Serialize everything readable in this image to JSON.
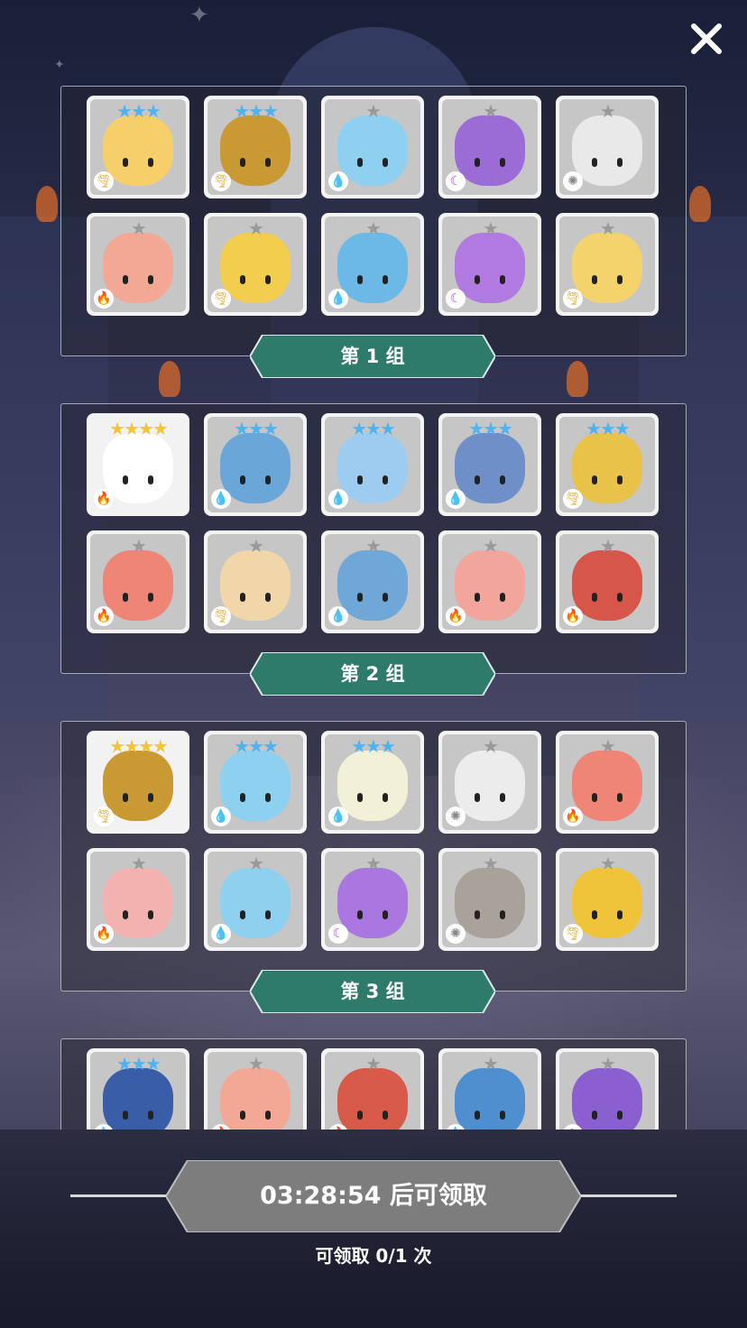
{
  "close_label": "✕",
  "groups": [
    {
      "label": "第 1 组",
      "heroes": [
        {
          "stars": "★★★",
          "star_color": "#4fb3f0",
          "element": "wind",
          "element_glyph": "🌪",
          "element_color": "#e8a21a",
          "color": "#f6cf6a",
          "gold": false
        },
        {
          "stars": "★★★",
          "star_color": "#4fb3f0",
          "element": "wind",
          "element_glyph": "🌪",
          "element_color": "#e8a21a",
          "color": "#c99a33",
          "gold": false
        },
        {
          "stars": "★",
          "star_color": "#9a9a9a",
          "element": "water",
          "element_glyph": "💧",
          "element_color": "#3a8fe0",
          "color": "#8fcfef",
          "gold": false
        },
        {
          "stars": "★",
          "star_color": "#9a9a9a",
          "element": "dark",
          "element_glyph": "☾",
          "element_color": "#b14ad8",
          "color": "#9b6bd6",
          "gold": false
        },
        {
          "stars": "★",
          "star_color": "#9a9a9a",
          "element": "light",
          "element_glyph": "✺",
          "element_color": "#888888",
          "color": "#e9e9e9",
          "gold": false
        },
        {
          "stars": "★",
          "star_color": "#9a9a9a",
          "element": "fire",
          "element_glyph": "🔥",
          "element_color": "#e25a2a",
          "color": "#f3a895",
          "gold": false
        },
        {
          "stars": "★",
          "star_color": "#9a9a9a",
          "element": "wind",
          "element_glyph": "🌪",
          "element_color": "#e8a21a",
          "color": "#f3cd4e",
          "gold": false
        },
        {
          "stars": "★",
          "star_color": "#9a9a9a",
          "element": "water",
          "element_glyph": "💧",
          "element_color": "#3a8fe0",
          "color": "#6cb9e8",
          "gold": false
        },
        {
          "stars": "★",
          "star_color": "#9a9a9a",
          "element": "dark",
          "element_glyph": "☾",
          "element_color": "#b14ad8",
          "color": "#b07ae0",
          "gold": false
        },
        {
          "stars": "★",
          "star_color": "#9a9a9a",
          "element": "wind",
          "element_glyph": "🌪",
          "element_color": "#e8a21a",
          "color": "#f5d36c",
          "gold": false
        }
      ]
    },
    {
      "label": "第 2 组",
      "heroes": [
        {
          "stars": "★★★★",
          "star_color": "#f2c53a",
          "element": "fire",
          "element_glyph": "🔥",
          "element_color": "#e25a2a",
          "color": "#ffffff",
          "gold": true
        },
        {
          "stars": "★★★",
          "star_color": "#4fb3f0",
          "element": "water",
          "element_glyph": "💧",
          "element_color": "#3a8fe0",
          "color": "#6aa7d8",
          "gold": false
        },
        {
          "stars": "★★★",
          "star_color": "#4fb3f0",
          "element": "water",
          "element_glyph": "💧",
          "element_color": "#3a8fe0",
          "color": "#9ecbf0",
          "gold": false
        },
        {
          "stars": "★★★",
          "star_color": "#4fb3f0",
          "element": "water",
          "element_glyph": "💧",
          "element_color": "#3a8fe0",
          "color": "#6f8fc8",
          "gold": false
        },
        {
          "stars": "★★★",
          "star_color": "#4fb3f0",
          "element": "wind",
          "element_glyph": "🌪",
          "element_color": "#e8a21a",
          "color": "#e9c24a",
          "gold": false
        },
        {
          "stars": "★",
          "star_color": "#9a9a9a",
          "element": "fire",
          "element_glyph": "🔥",
          "element_color": "#e25a2a",
          "color": "#ef8577",
          "gold": false
        },
        {
          "stars": "★",
          "star_color": "#9a9a9a",
          "element": "wind",
          "element_glyph": "🌪",
          "element_color": "#e8a21a",
          "color": "#f0d6a8",
          "gold": false
        },
        {
          "stars": "★",
          "star_color": "#9a9a9a",
          "element": "water",
          "element_glyph": "💧",
          "element_color": "#3a8fe0",
          "color": "#6fa8d8",
          "gold": false
        },
        {
          "stars": "★",
          "star_color": "#9a9a9a",
          "element": "fire",
          "element_glyph": "🔥",
          "element_color": "#e25a2a",
          "color": "#f2a59a",
          "gold": false
        },
        {
          "stars": "★",
          "star_color": "#9a9a9a",
          "element": "fire",
          "element_glyph": "🔥",
          "element_color": "#e25a2a",
          "color": "#d7564a",
          "gold": false
        }
      ]
    },
    {
      "label": "第 3 组",
      "heroes": [
        {
          "stars": "★★★★",
          "star_color": "#f2c53a",
          "element": "wind",
          "element_glyph": "🌪",
          "element_color": "#e8a21a",
          "color": "#c99a33",
          "gold": true
        },
        {
          "stars": "★★★",
          "star_color": "#4fb3f0",
          "element": "water",
          "element_glyph": "💧",
          "element_color": "#3a8fe0",
          "color": "#8ed0ef",
          "gold": false
        },
        {
          "stars": "★★★",
          "star_color": "#4fb3f0",
          "element": "water",
          "element_glyph": "💧",
          "element_color": "#3a8fe0",
          "color": "#f3f0d8",
          "gold": false
        },
        {
          "stars": "★",
          "star_color": "#9a9a9a",
          "element": "light",
          "element_glyph": "✺",
          "element_color": "#888888",
          "color": "#ececec",
          "gold": false
        },
        {
          "stars": "★",
          "star_color": "#9a9a9a",
          "element": "fire",
          "element_glyph": "🔥",
          "element_color": "#e25a2a",
          "color": "#ef8577",
          "gold": false
        },
        {
          "stars": "★",
          "star_color": "#9a9a9a",
          "element": "fire",
          "element_glyph": "🔥",
          "element_color": "#e25a2a",
          "color": "#f2b3b0",
          "gold": false
        },
        {
          "stars": "★",
          "star_color": "#9a9a9a",
          "element": "water",
          "element_glyph": "💧",
          "element_color": "#3a8fe0",
          "color": "#8fd0ef",
          "gold": false
        },
        {
          "stars": "★",
          "star_color": "#9a9a9a",
          "element": "dark",
          "element_glyph": "☾",
          "element_color": "#b14ad8",
          "color": "#a977df",
          "gold": false
        },
        {
          "stars": "★",
          "star_color": "#9a9a9a",
          "element": "light",
          "element_glyph": "✺",
          "element_color": "#888888",
          "color": "#a8a29a",
          "gold": false
        },
        {
          "stars": "★",
          "star_color": "#9a9a9a",
          "element": "wind",
          "element_glyph": "🌪",
          "element_color": "#e8a21a",
          "color": "#f0c43a",
          "gold": false
        }
      ]
    },
    {
      "label": "",
      "heroes": [
        {
          "stars": "★★★",
          "star_color": "#4fb3f0",
          "element": "water",
          "element_glyph": "💧",
          "element_color": "#3a8fe0",
          "color": "#3a5da8",
          "gold": false
        },
        {
          "stars": "★",
          "star_color": "#9a9a9a",
          "element": "fire",
          "element_glyph": "🔥",
          "element_color": "#e25a2a",
          "color": "#f3a895",
          "gold": false
        },
        {
          "stars": "★",
          "star_color": "#9a9a9a",
          "element": "fire",
          "element_glyph": "🔥",
          "element_color": "#e25a2a",
          "color": "#d75a4a",
          "gold": false
        },
        {
          "stars": "★",
          "star_color": "#9a9a9a",
          "element": "water",
          "element_glyph": "💧",
          "element_color": "#3a8fe0",
          "color": "#4f8fd0",
          "gold": false
        },
        {
          "stars": "★",
          "star_color": "#9a9a9a",
          "element": "dark",
          "element_glyph": "☾",
          "element_color": "#b14ad8",
          "color": "#8a5fd0",
          "gold": false
        }
      ]
    }
  ],
  "claim": {
    "button_label": "03:28:54 后可领取",
    "count_label": "可领取 0/1 次",
    "button_color": "#7d7d7d"
  },
  "group_label_color": "#2f7b6b"
}
